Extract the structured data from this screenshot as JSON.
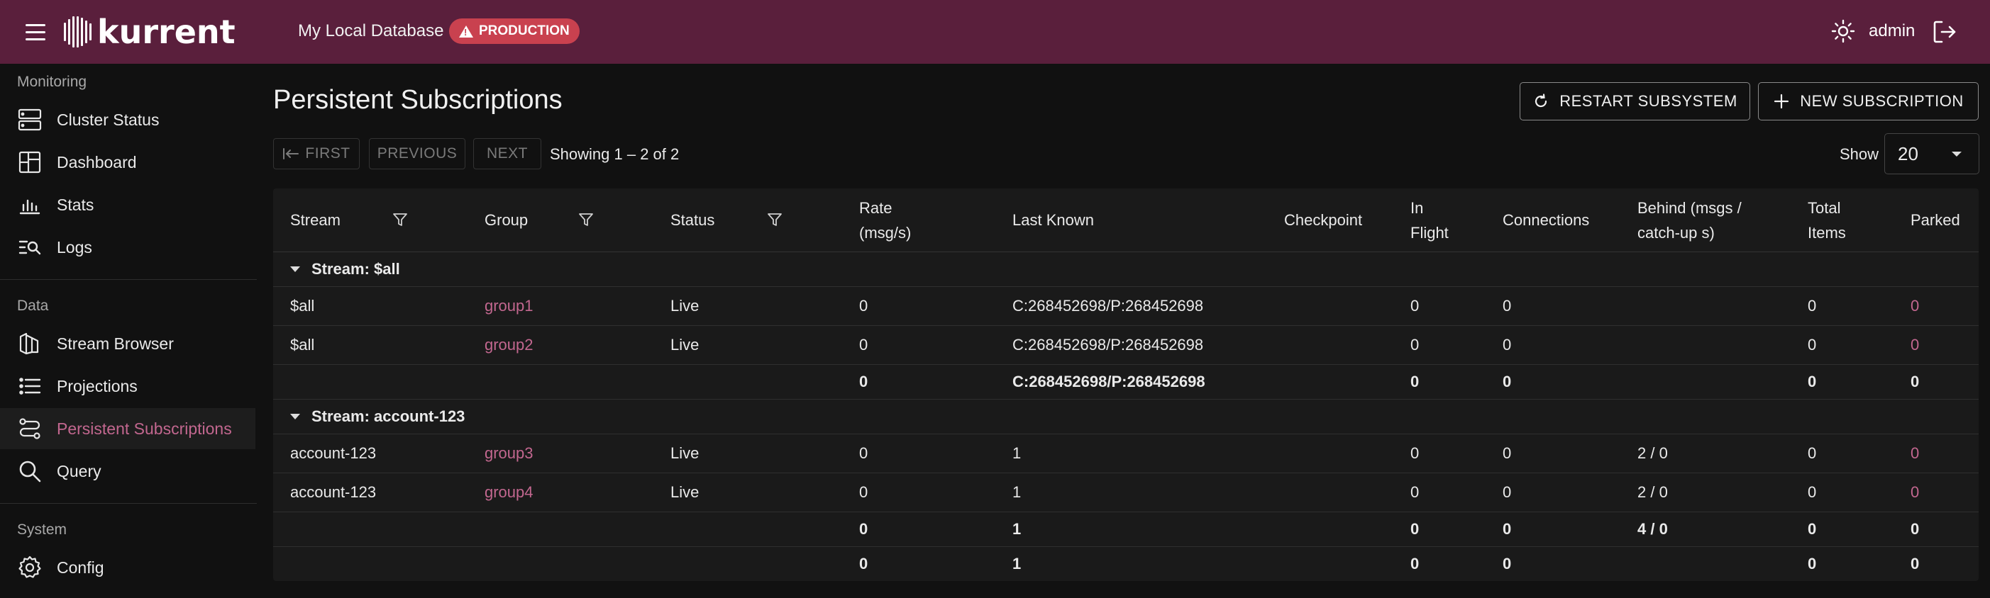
{
  "topbar": {
    "logo_text": "kurrent",
    "db_name": "My Local Database",
    "env_badge": "PRODUCTION",
    "user": "admin"
  },
  "colors": {
    "topbar": "#5a1f3c",
    "accent": "#c2678f",
    "badge": "#c9414f"
  },
  "sidebar": {
    "sections": [
      {
        "label": "Monitoring",
        "items": [
          {
            "label": "Cluster Status",
            "icon": "server-icon"
          },
          {
            "label": "Dashboard",
            "icon": "dashboard-icon"
          },
          {
            "label": "Stats",
            "icon": "bar-chart-icon"
          },
          {
            "label": "Logs",
            "icon": "search-list-icon"
          }
        ]
      },
      {
        "label": "Data",
        "items": [
          {
            "label": "Stream Browser",
            "icon": "stream-icon"
          },
          {
            "label": "Projections",
            "icon": "list-icon"
          },
          {
            "label": "Persistent Subscriptions",
            "icon": "subscriptions-icon",
            "active": true
          },
          {
            "label": "Query",
            "icon": "search-icon"
          }
        ]
      },
      {
        "label": "System",
        "items": [
          {
            "label": "Config",
            "icon": "gear-icon"
          }
        ]
      }
    ]
  },
  "main": {
    "title": "Persistent Subscriptions",
    "restart_label": "RESTART SUBSYSTEM",
    "new_label": "NEW SUBSCRIPTION",
    "pager": {
      "first": "FIRST",
      "previous": "PREVIOUS",
      "next": "NEXT",
      "showing": "Showing 1 – 2 of 2"
    },
    "show_label": "Show",
    "page_size": "20"
  },
  "table": {
    "headers": {
      "stream": "Stream",
      "group": "Group",
      "status": "Status",
      "rate_1": "Rate",
      "rate_2": "(msg/s)",
      "last_known": "Last Known",
      "checkpoint": "Checkpoint",
      "inflight_1": "In",
      "inflight_2": "Flight",
      "connections": "Connections",
      "behind_1": "Behind (msgs /",
      "behind_2": "catch-up s)",
      "total_1": "Total",
      "total_2": "Items",
      "parked": "Parked"
    },
    "groups": [
      {
        "title": "Stream: $all",
        "rows": [
          {
            "stream": "$all",
            "group": "group1",
            "status": "Live",
            "rate": "0",
            "last_known": "C:268452698/P:268452698",
            "checkpoint": "",
            "in_flight": "0",
            "connections": "0",
            "behind": "",
            "total": "0",
            "parked": "0"
          },
          {
            "stream": "$all",
            "group": "group2",
            "status": "Live",
            "rate": "0",
            "last_known": "C:268452698/P:268452698",
            "checkpoint": "",
            "in_flight": "0",
            "connections": "0",
            "behind": "",
            "total": "0",
            "parked": "0"
          }
        ],
        "subtotal": {
          "rate": "0",
          "last_known": "C:268452698/P:268452698",
          "in_flight": "0",
          "connections": "0",
          "behind": "",
          "total": "0",
          "parked": "0"
        }
      },
      {
        "title": "Stream: account-123",
        "rows": [
          {
            "stream": "account-123",
            "group": "group3",
            "status": "Live",
            "rate": "0",
            "last_known": "1",
            "checkpoint": "",
            "in_flight": "0",
            "connections": "0",
            "behind": "2 / 0",
            "total": "0",
            "parked": "0"
          },
          {
            "stream": "account-123",
            "group": "group4",
            "status": "Live",
            "rate": "0",
            "last_known": "1",
            "checkpoint": "",
            "in_flight": "0",
            "connections": "0",
            "behind": "2 / 0",
            "total": "0",
            "parked": "0"
          }
        ],
        "subtotal": {
          "rate": "0",
          "last_known": "1",
          "in_flight": "0",
          "connections": "0",
          "behind": "4 / 0",
          "total": "0",
          "parked": "0"
        }
      }
    ],
    "grand_total": {
      "rate": "0",
      "last_known": "1",
      "in_flight": "0",
      "connections": "0",
      "behind": "",
      "total": "0",
      "parked": "0"
    }
  }
}
